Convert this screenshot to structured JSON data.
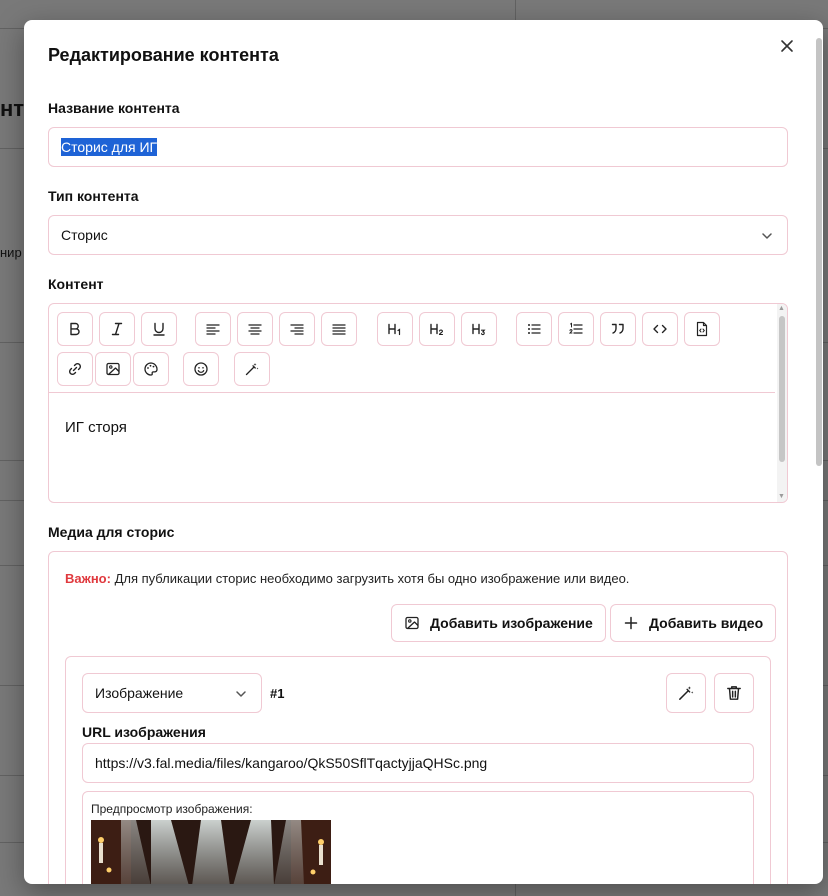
{
  "background": {
    "fragments": [
      "нто",
      "нир"
    ]
  },
  "modal": {
    "title": "Редактирование контента",
    "close_icon": "close-icon"
  },
  "form": {
    "name_label": "Название контента",
    "name_value": "Сторис для ИГ",
    "type_label": "Тип контента",
    "type_value": "Сторис",
    "content_label": "Контент"
  },
  "editor": {
    "toolbar_icons": [
      "bold-icon",
      "italic-icon",
      "underline-icon",
      "align-left-icon",
      "align-center-icon",
      "align-right-icon",
      "align-justify-icon",
      "heading-1-icon",
      "heading-2-icon",
      "heading-3-icon",
      "bullet-list-icon",
      "numbered-list-icon",
      "quote-icon",
      "code-icon",
      "code-file-icon",
      "link-icon",
      "image-icon",
      "palette-icon",
      "emoji-icon",
      "magic-wand-icon"
    ],
    "content": "ИГ сторя"
  },
  "media": {
    "label": "Медиа для сторис",
    "important_prefix": "Важно:",
    "important_text": " Для публикации сторис необходимо загрузить хотя бы одно изображение или видео.",
    "add_image_label": "Добавить изображение",
    "add_video_label": "Добавить видео",
    "item": {
      "type_value": "Изображение",
      "number": "#1",
      "url_label": "URL изображения",
      "url_value": "https://v3.fal.media/files/kangaroo/QkS50SflTqactyjjaQHSc.png",
      "preview_label": "Предпросмотр изображения:"
    }
  },
  "colors": {
    "accent_border": "#f0c9d3",
    "warning": "#e0393e",
    "selection": "#1e63d6"
  }
}
